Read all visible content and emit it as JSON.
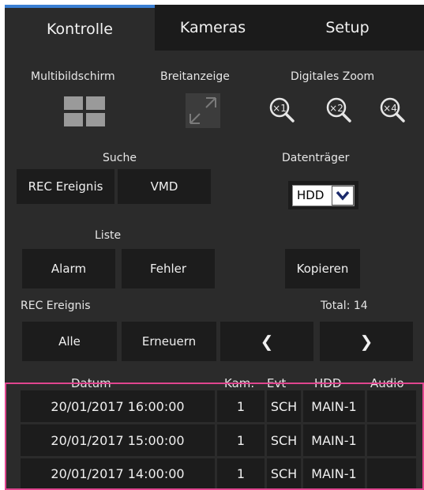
{
  "tabs": [
    {
      "label": "Kontrolle",
      "active": true
    },
    {
      "label": "Kameras",
      "active": false
    },
    {
      "label": "Setup",
      "active": false
    }
  ],
  "view": {
    "multi_label": "Multibildschirm",
    "wide_label": "Breitanzeige",
    "zoom_label": "Digitales Zoom",
    "zoom_levels": [
      "×1",
      "×2",
      "×4"
    ]
  },
  "search": {
    "label": "Suche",
    "rec_event_button": "REC Ereignis",
    "vmd_button": "VMD"
  },
  "media": {
    "label": "Datenträger",
    "selected": "HDD"
  },
  "list": {
    "label": "Liste",
    "alarm_button": "Alarm",
    "error_button": "Fehler",
    "copy_button": "Kopieren"
  },
  "rec_events": {
    "label": "REC Ereignis",
    "total_text": "Total: 14",
    "all_button": "Alle",
    "refresh_button": "Erneuern",
    "prev_glyph": "❮",
    "next_glyph": "❯"
  },
  "table": {
    "columns": [
      "Datum",
      "Kam.",
      "Evt",
      "HDD",
      "Audio"
    ],
    "rows": [
      {
        "date": "20/01/2017  16:00:00",
        "cam": "1",
        "evt": "SCH",
        "hdd": "MAIN-1",
        "audio": ""
      },
      {
        "date": "20/01/2017  15:00:00",
        "cam": "1",
        "evt": "SCH",
        "hdd": "MAIN-1",
        "audio": ""
      },
      {
        "date": "20/01/2017  14:00:00",
        "cam": "1",
        "evt": "SCH",
        "hdd": "MAIN-1",
        "audio": ""
      }
    ]
  },
  "colors": {
    "panel_bg": "#2b2b2b",
    "button_bg": "#1c1c1c",
    "active_tab_accent": "#3b7fd3",
    "selection_frame": "#e0458f"
  }
}
